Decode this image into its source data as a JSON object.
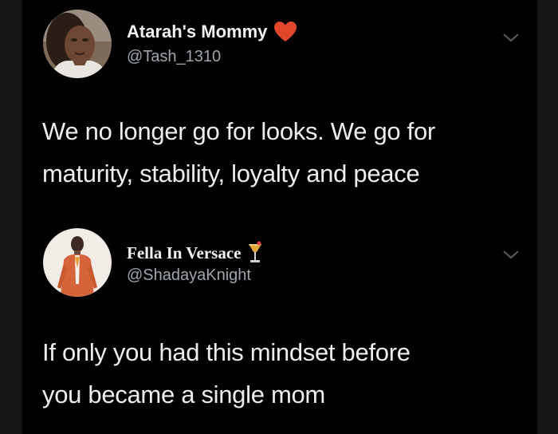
{
  "tweets": [
    {
      "display_name": "Atarah's Mommy",
      "badge": "heart-emoji",
      "handle": "@Tash_1310",
      "text_lines": [
        "We no longer go for looks. We go for",
        "maturity, stability, loyalty and peace"
      ]
    },
    {
      "display_name": "Fella In Versace",
      "badge": "drink-emoji",
      "handle": "@ShadayaKnight",
      "text_lines": [
        "If only you had this mindset before",
        "you became a single mom"
      ]
    }
  ],
  "colors": {
    "background": "#000000",
    "text": "#ededed",
    "handle": "#a0a6ad",
    "heart": "#e0462c"
  }
}
